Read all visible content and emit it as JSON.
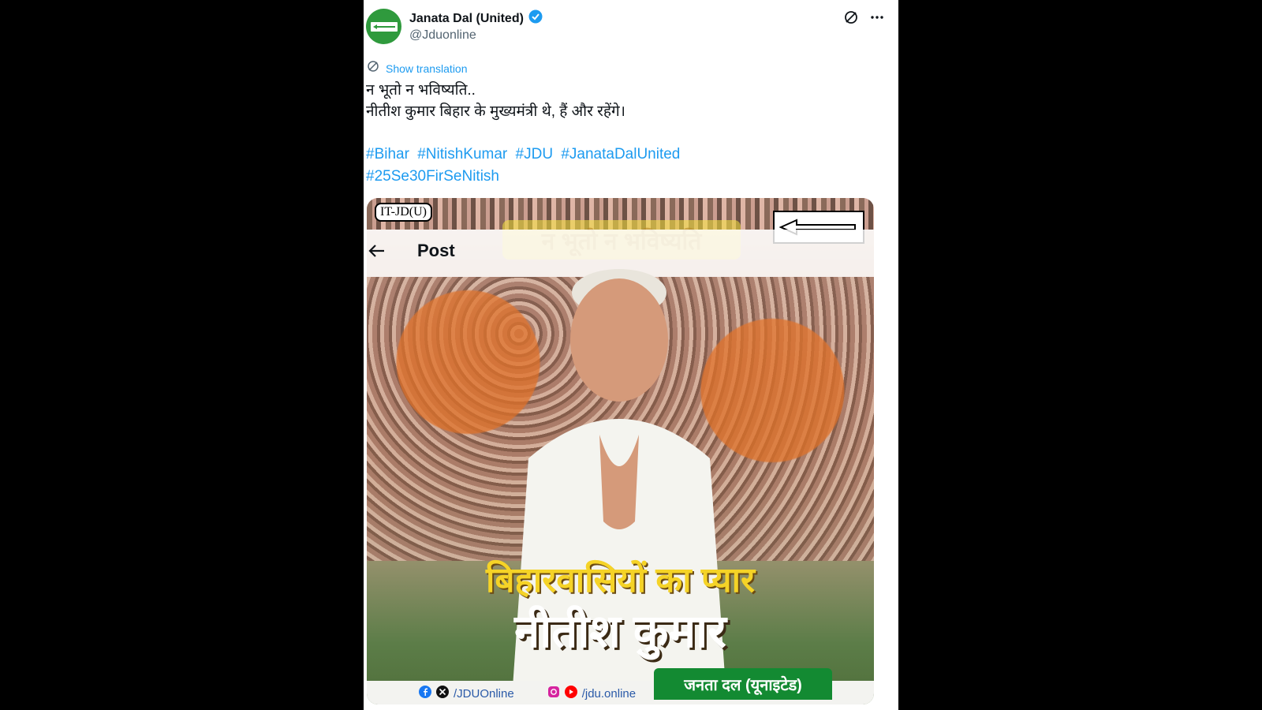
{
  "account": {
    "name": "Janata Dal (United)",
    "handle": "@Jduonline",
    "verified_color": "#1d9bf0"
  },
  "tweet": {
    "show_translation": "Show translation",
    "line1": "न भूतो न भविष्यति..",
    "line2": "नीतीश कुमार बिहार के मुख्यमंत्री थे, हैं और रहेंगे।",
    "hashtags": [
      "#Bihar",
      "#NitishKumar",
      "#JDU",
      "#JanataDalUnited",
      "#25Se30FirSeNitish"
    ]
  },
  "media": {
    "watermark": "IT-JD(U)",
    "headline": "न भूतो न भविष्यति",
    "overlay_title": "Post",
    "caption_top": "बिहारवासियों का प्यार",
    "caption_bottom": "नीतीश कुमार",
    "social_x": "/JDUOnline",
    "social_insta": "/jdu.online",
    "party_label": "जनता दल (यूनाइटेड)"
  },
  "colors": {
    "accent": "#1d9bf0",
    "party_green": "#138a32",
    "caption_yellow": "#f5d327"
  },
  "icons": [
    "verified-badge-icon",
    "grok-icon",
    "more-icon",
    "translate-icon",
    "back-arrow-icon",
    "facebook-icon",
    "x-icon",
    "instagram-icon",
    "youtube-icon",
    "arrow-logo-icon"
  ]
}
